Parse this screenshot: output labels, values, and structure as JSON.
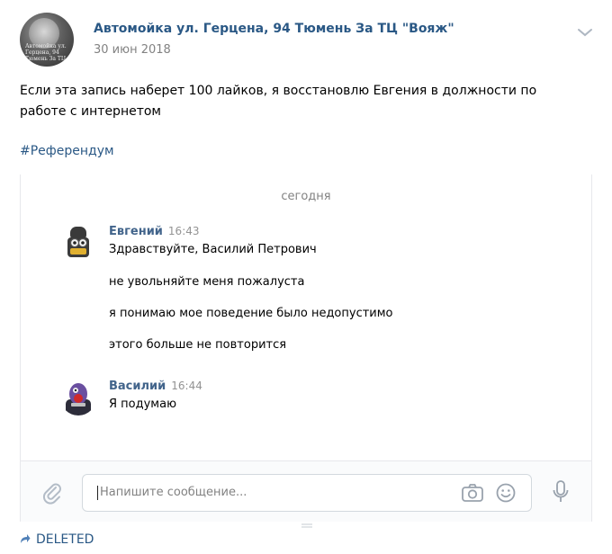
{
  "post": {
    "author": "Автомойка ул. Герцена, 94 Тюмень За ТЦ \"Вояж\"",
    "date": "30 июн 2018",
    "avatar_text": "Автомойка ул. Герцена, 94 Тюмень За ТЦ",
    "text_line1": "Если эта запись наберет 100 лайков, я восстановлю Евгения в должности по",
    "text_line2": "работе с интернетом",
    "hashtag": "#Референдум"
  },
  "chat": {
    "day_separator": "сегодня",
    "messages": [
      {
        "sender": "Евгений",
        "time": "16:43",
        "lines": [
          "Здравствуйте, Василий Петрович",
          "не увольняйте меня пожалуста",
          "я понимаю мое поведение было недопустимо",
          "этого больше не повторится"
        ]
      },
      {
        "sender": "Василий",
        "time": "16:44",
        "lines": [
          "Я подумаю"
        ]
      }
    ],
    "composer": {
      "placeholder": "Напишите сообщение..."
    }
  },
  "footer": {
    "label": "DELETED"
  },
  "icons": {
    "menu": "chevron-down-icon",
    "attach": "paperclip-icon",
    "camera": "camera-icon",
    "emoji": "smile-icon",
    "voice": "microphone-icon",
    "share": "share-icon"
  },
  "colors": {
    "link": "#2a5885",
    "name": "#42648b",
    "muted": "#828282",
    "border": "#e7e8ec"
  }
}
